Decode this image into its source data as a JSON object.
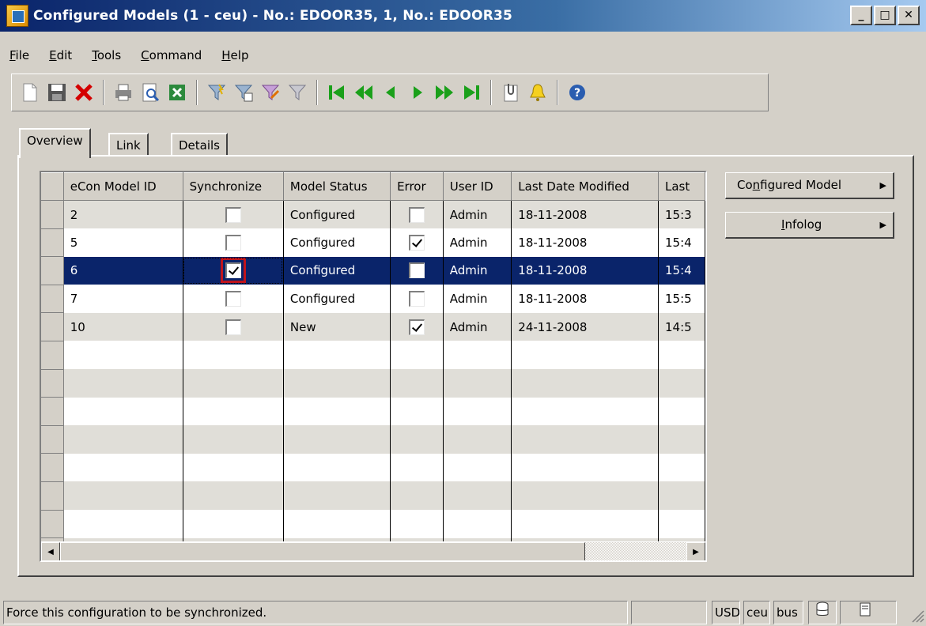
{
  "window": {
    "title": "Configured Models (1 - ceu) - No.: EDOOR35, 1, No.: EDOOR35",
    "minimize": "_",
    "maximize": "□",
    "close": "✕"
  },
  "menu": [
    {
      "label": "File",
      "mnemonic": "F",
      "rest": "ile"
    },
    {
      "label": "Edit",
      "mnemonic": "E",
      "rest": "dit"
    },
    {
      "label": "Tools",
      "mnemonic": "T",
      "rest": "ools"
    },
    {
      "label": "Command",
      "mnemonic": "C",
      "rest": "ommand"
    },
    {
      "label": "Help",
      "mnemonic": "H",
      "rest": "elp"
    }
  ],
  "toolbar": {
    "icons": [
      "new-icon",
      "save-icon",
      "delete-icon",
      "print-icon",
      "print-preview-icon",
      "excel-icon",
      "filter-by-selection-icon",
      "filter-by-grid-icon",
      "advanced-filter-icon",
      "remove-filter-icon",
      "first-record-icon",
      "previous-page-icon",
      "previous-record-icon",
      "next-record-icon",
      "next-page-icon",
      "last-record-icon",
      "attachments-icon",
      "alert-icon",
      "help-icon"
    ]
  },
  "tabs": [
    {
      "label": "Overview",
      "active": true
    },
    {
      "label": "Link",
      "active": false
    },
    {
      "label": "Details",
      "active": false
    }
  ],
  "grid": {
    "columns": [
      "eCon Model ID",
      "Synchronize",
      "Model Status",
      "Error",
      "User ID",
      "Last Date Modified",
      "Last"
    ],
    "rows": [
      {
        "id": "2",
        "synchronize": false,
        "status": "Configured",
        "error": false,
        "user": "Admin",
        "date": "18-11-2008",
        "time": "15:3"
      },
      {
        "id": "5",
        "synchronize": false,
        "status": "Configured",
        "error": true,
        "user": "Admin",
        "date": "18-11-2008",
        "time": "15:4"
      },
      {
        "id": "6",
        "synchronize": true,
        "status": "Configured",
        "error": false,
        "user": "Admin",
        "date": "18-11-2008",
        "time": "15:4"
      },
      {
        "id": "7",
        "synchronize": false,
        "status": "Configured",
        "error": false,
        "user": "Admin",
        "date": "18-11-2008",
        "time": "15:5"
      },
      {
        "id": "10",
        "synchronize": false,
        "status": "New",
        "error": true,
        "user": "Admin",
        "date": "24-11-2008",
        "time": "14:5"
      }
    ],
    "selected_row_index": 2,
    "empty_rows": 8
  },
  "side_buttons": {
    "configured_model": {
      "prefix": "Co",
      "mnemonic": "n",
      "rest": "figured Model"
    },
    "infolog": {
      "mnemonic": "I",
      "rest": "nfolog"
    }
  },
  "status": {
    "message": "Force this configuration to be synchronized.",
    "currency": "USD",
    "company": "ceu",
    "layer": "bus"
  },
  "colors": {
    "selection": "#0a246a",
    "highlight_frame": "#c0141c",
    "window_face": "#d4d0c8"
  }
}
